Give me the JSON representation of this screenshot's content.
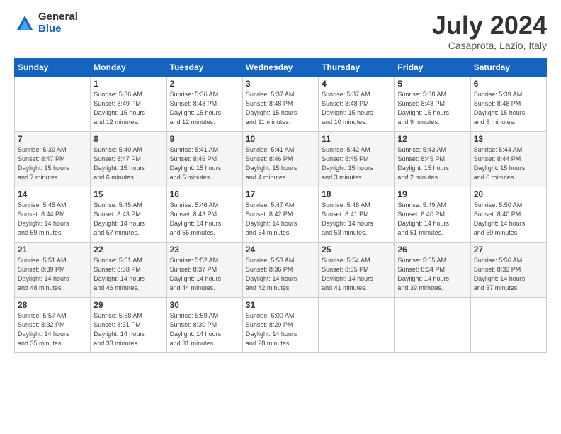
{
  "logo": {
    "general": "General",
    "blue": "Blue"
  },
  "title": "July 2024",
  "subtitle": "Casaprota, Lazio, Italy",
  "days_header": [
    "Sunday",
    "Monday",
    "Tuesday",
    "Wednesday",
    "Thursday",
    "Friday",
    "Saturday"
  ],
  "weeks": [
    [
      {
        "day": "",
        "info": ""
      },
      {
        "day": "1",
        "info": "Sunrise: 5:36 AM\nSunset: 8:49 PM\nDaylight: 15 hours\nand 12 minutes."
      },
      {
        "day": "2",
        "info": "Sunrise: 5:36 AM\nSunset: 8:48 PM\nDaylight: 15 hours\nand 12 minutes."
      },
      {
        "day": "3",
        "info": "Sunrise: 5:37 AM\nSunset: 8:48 PM\nDaylight: 15 hours\nand 11 minutes."
      },
      {
        "day": "4",
        "info": "Sunrise: 5:37 AM\nSunset: 8:48 PM\nDaylight: 15 hours\nand 10 minutes."
      },
      {
        "day": "5",
        "info": "Sunrise: 5:38 AM\nSunset: 8:48 PM\nDaylight: 15 hours\nand 9 minutes."
      },
      {
        "day": "6",
        "info": "Sunrise: 5:39 AM\nSunset: 8:48 PM\nDaylight: 15 hours\nand 8 minutes."
      }
    ],
    [
      {
        "day": "7",
        "info": "Sunrise: 5:39 AM\nSunset: 8:47 PM\nDaylight: 15 hours\nand 7 minutes."
      },
      {
        "day": "8",
        "info": "Sunrise: 5:40 AM\nSunset: 8:47 PM\nDaylight: 15 hours\nand 6 minutes."
      },
      {
        "day": "9",
        "info": "Sunrise: 5:41 AM\nSunset: 8:46 PM\nDaylight: 15 hours\nand 5 minutes."
      },
      {
        "day": "10",
        "info": "Sunrise: 5:41 AM\nSunset: 8:46 PM\nDaylight: 15 hours\nand 4 minutes."
      },
      {
        "day": "11",
        "info": "Sunrise: 5:42 AM\nSunset: 8:45 PM\nDaylight: 15 hours\nand 3 minutes."
      },
      {
        "day": "12",
        "info": "Sunrise: 5:43 AM\nSunset: 8:45 PM\nDaylight: 15 hours\nand 2 minutes."
      },
      {
        "day": "13",
        "info": "Sunrise: 5:44 AM\nSunset: 8:44 PM\nDaylight: 15 hours\nand 0 minutes."
      }
    ],
    [
      {
        "day": "14",
        "info": "Sunrise: 5:45 AM\nSunset: 8:44 PM\nDaylight: 14 hours\nand 59 minutes."
      },
      {
        "day": "15",
        "info": "Sunrise: 5:45 AM\nSunset: 8:43 PM\nDaylight: 14 hours\nand 57 minutes."
      },
      {
        "day": "16",
        "info": "Sunrise: 5:46 AM\nSunset: 8:43 PM\nDaylight: 14 hours\nand 56 minutes."
      },
      {
        "day": "17",
        "info": "Sunrise: 5:47 AM\nSunset: 8:42 PM\nDaylight: 14 hours\nand 54 minutes."
      },
      {
        "day": "18",
        "info": "Sunrise: 5:48 AM\nSunset: 8:41 PM\nDaylight: 14 hours\nand 53 minutes."
      },
      {
        "day": "19",
        "info": "Sunrise: 5:49 AM\nSunset: 8:40 PM\nDaylight: 14 hours\nand 51 minutes."
      },
      {
        "day": "20",
        "info": "Sunrise: 5:50 AM\nSunset: 8:40 PM\nDaylight: 14 hours\nand 50 minutes."
      }
    ],
    [
      {
        "day": "21",
        "info": "Sunrise: 5:51 AM\nSunset: 8:39 PM\nDaylight: 14 hours\nand 48 minutes."
      },
      {
        "day": "22",
        "info": "Sunrise: 5:51 AM\nSunset: 8:38 PM\nDaylight: 14 hours\nand 46 minutes."
      },
      {
        "day": "23",
        "info": "Sunrise: 5:52 AM\nSunset: 8:37 PM\nDaylight: 14 hours\nand 44 minutes."
      },
      {
        "day": "24",
        "info": "Sunrise: 5:53 AM\nSunset: 8:36 PM\nDaylight: 14 hours\nand 42 minutes."
      },
      {
        "day": "25",
        "info": "Sunrise: 5:54 AM\nSunset: 8:35 PM\nDaylight: 14 hours\nand 41 minutes."
      },
      {
        "day": "26",
        "info": "Sunrise: 5:55 AM\nSunset: 8:34 PM\nDaylight: 14 hours\nand 39 minutes."
      },
      {
        "day": "27",
        "info": "Sunrise: 5:56 AM\nSunset: 8:33 PM\nDaylight: 14 hours\nand 37 minutes."
      }
    ],
    [
      {
        "day": "28",
        "info": "Sunrise: 5:57 AM\nSunset: 8:32 PM\nDaylight: 14 hours\nand 35 minutes."
      },
      {
        "day": "29",
        "info": "Sunrise: 5:58 AM\nSunset: 8:31 PM\nDaylight: 14 hours\nand 33 minutes."
      },
      {
        "day": "30",
        "info": "Sunrise: 5:59 AM\nSunset: 8:30 PM\nDaylight: 14 hours\nand 31 minutes."
      },
      {
        "day": "31",
        "info": "Sunrise: 6:00 AM\nSunset: 8:29 PM\nDaylight: 14 hours\nand 28 minutes."
      },
      {
        "day": "",
        "info": ""
      },
      {
        "day": "",
        "info": ""
      },
      {
        "day": "",
        "info": ""
      }
    ]
  ]
}
